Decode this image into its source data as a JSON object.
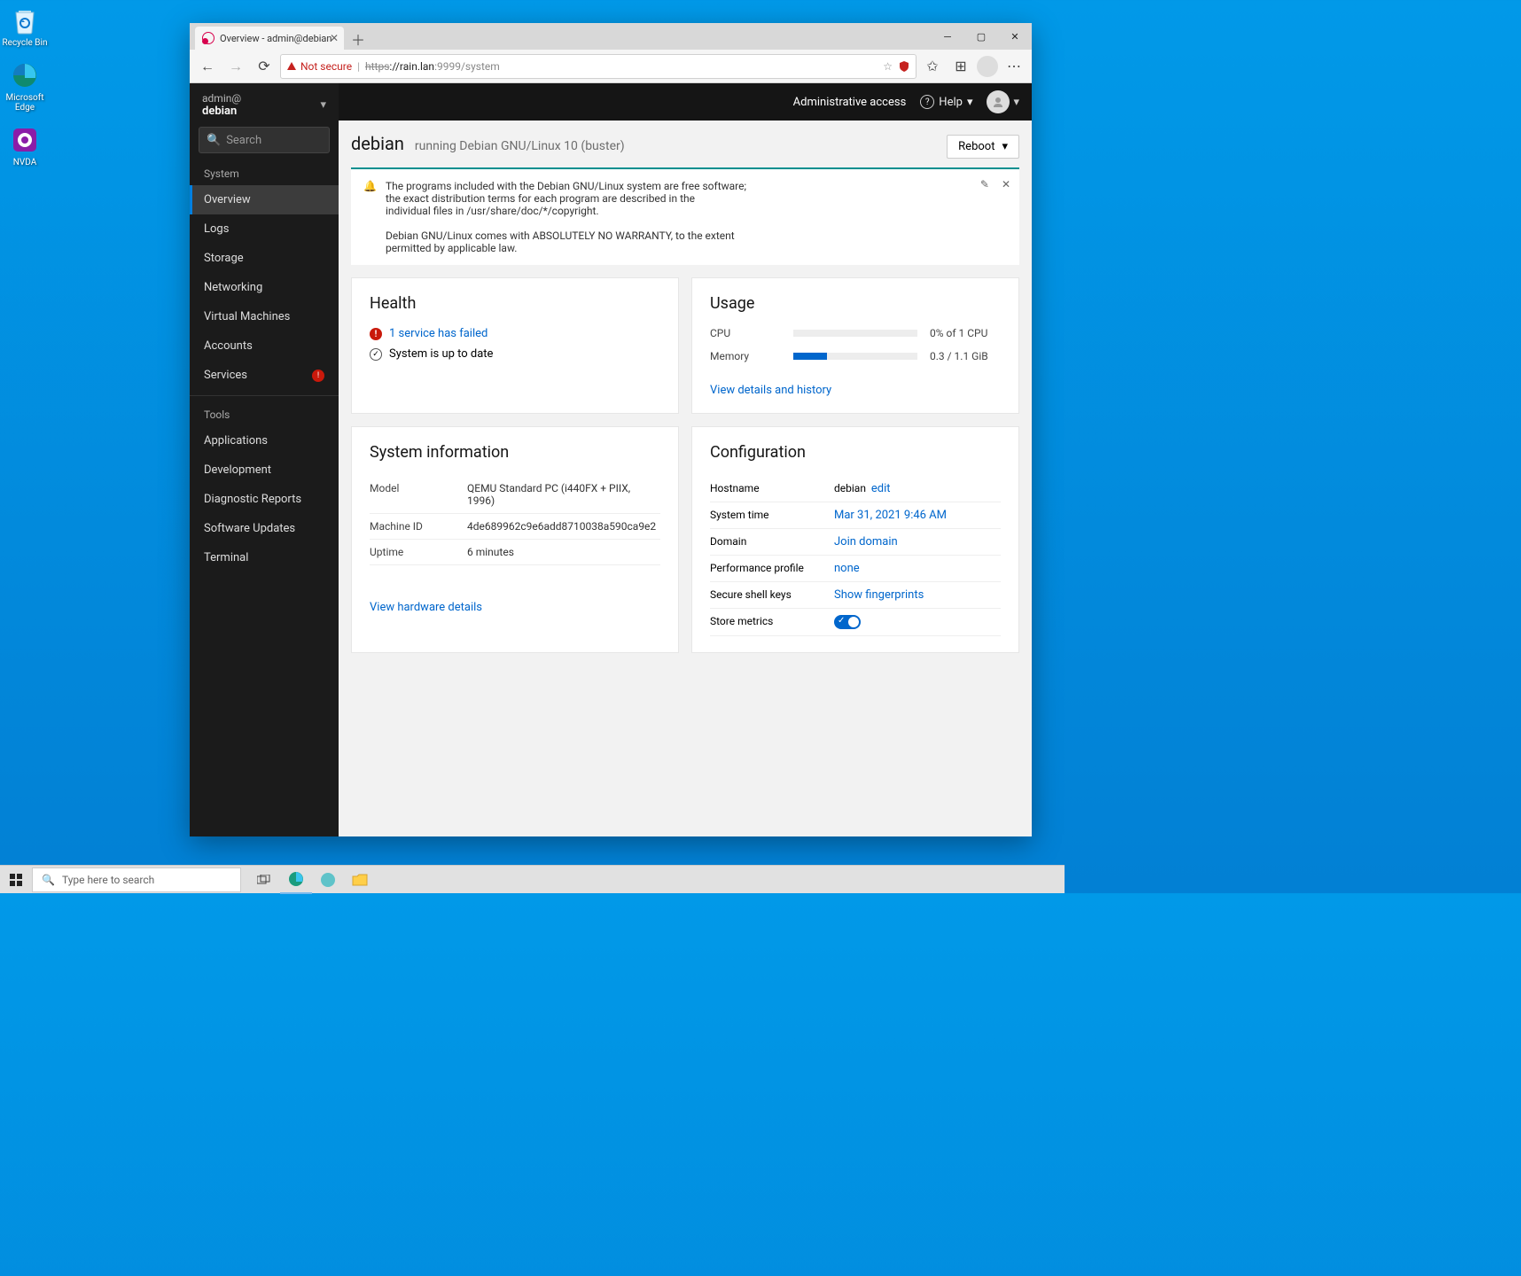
{
  "desktop": {
    "icons": [
      {
        "label": "Recycle Bin"
      },
      {
        "label": "Microsoft Edge"
      },
      {
        "label": "NVDA"
      }
    ]
  },
  "taskbar": {
    "search_placeholder": "Type here to search"
  },
  "browser": {
    "tab_title": "Overview - admin@debian",
    "not_secure": "Not secure",
    "url_proto": "https",
    "url_host": "://rain.lan",
    "url_portpath": ":9999/system"
  },
  "sidebar": {
    "user_top": "admin@",
    "user_host": "debian",
    "search_placeholder": "Search",
    "section_system": "System",
    "items": [
      {
        "label": "Overview",
        "active": true
      },
      {
        "label": "Logs"
      },
      {
        "label": "Storage"
      },
      {
        "label": "Networking"
      },
      {
        "label": "Virtual Machines"
      },
      {
        "label": "Accounts"
      },
      {
        "label": "Services",
        "badge": "!"
      }
    ],
    "section_tools": "Tools",
    "tools": [
      {
        "label": "Applications"
      },
      {
        "label": "Development"
      },
      {
        "label": "Diagnostic Reports"
      },
      {
        "label": "Software Updates"
      },
      {
        "label": "Terminal"
      }
    ]
  },
  "topbar": {
    "admin": "Administrative access",
    "help": "Help"
  },
  "page": {
    "hostname": "debian",
    "subtitle": "running Debian GNU/Linux 10 (buster)",
    "reboot": "Reboot"
  },
  "motd": "The programs included with the Debian GNU/Linux system are free software;\nthe exact distribution terms for each program are described in the\nindividual files in /usr/share/doc/*/copyright.\n\nDebian GNU/Linux comes with ABSOLUTELY NO WARRANTY, to the extent\npermitted by applicable law.",
  "health": {
    "title": "Health",
    "service_failed": "1 service has failed",
    "up_to_date": "System is up to date"
  },
  "usage": {
    "title": "Usage",
    "cpu_label": "CPU",
    "cpu_text": "0% of 1 CPU",
    "cpu_pct": 0,
    "mem_label": "Memory",
    "mem_text": "0.3 / 1.1 GiB",
    "mem_pct": 27,
    "details": "View details and history"
  },
  "sysinfo": {
    "title": "System information",
    "rows": [
      {
        "k": "Model",
        "v": "QEMU Standard PC (i440FX + PIIX, 1996)"
      },
      {
        "k": "Machine ID",
        "v": "4de689962c9e6add8710038a590ca9e2"
      },
      {
        "k": "Uptime",
        "v": "6 minutes"
      }
    ],
    "hw_link": "View hardware details"
  },
  "config": {
    "title": "Configuration",
    "hostname_label": "Hostname",
    "hostname_value": "debian",
    "hostname_edit": "edit",
    "systime_label": "System time",
    "systime_value": "Mar 31, 2021 9:46 AM",
    "domain_label": "Domain",
    "domain_value": "Join domain",
    "perf_label": "Performance profile",
    "perf_value": "none",
    "ssh_label": "Secure shell keys",
    "ssh_value": "Show fingerprints",
    "metrics_label": "Store metrics"
  }
}
